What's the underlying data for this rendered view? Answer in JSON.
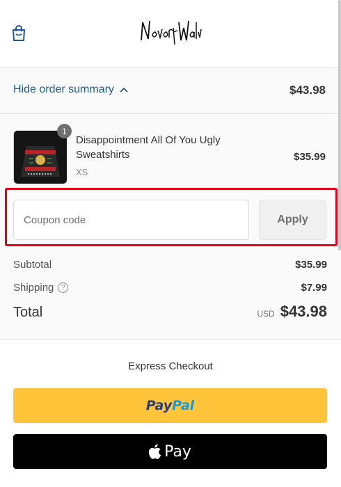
{
  "header": {
    "logo_text": "NeverWave",
    "cart_icon": "shopping-bag-icon"
  },
  "summary": {
    "toggle_label": "Hide order summary",
    "toggle_icon": "chevron-up-icon",
    "total": "$43.98"
  },
  "product": {
    "quantity": "1",
    "name": "Disappointment All Of You Ugly Sweatshirts",
    "variant": "XS",
    "price": "$35.99"
  },
  "coupon": {
    "placeholder": "Coupon code",
    "value": "",
    "apply_label": "Apply"
  },
  "totals": {
    "subtotal_label": "Subtotal",
    "subtotal_value": "$35.99",
    "shipping_label": "Shipping",
    "shipping_value": "$7.99",
    "total_label": "Total",
    "currency": "USD",
    "total_value": "$43.98"
  },
  "express": {
    "title": "Express Checkout",
    "paypal_part1": "Pay",
    "paypal_part2": "Pal",
    "applepay_label": "Pay",
    "apple_icon": "apple-icon"
  },
  "colors": {
    "link": "#1e5b94",
    "highlight_border": "#e3001b",
    "paypal_bg": "#ffc439",
    "paypal_dark": "#253b80",
    "paypal_light": "#179bd7"
  }
}
